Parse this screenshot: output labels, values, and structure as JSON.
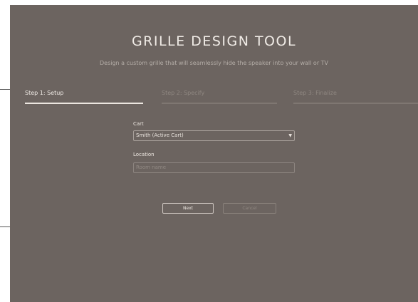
{
  "header": {
    "title": "GRILLE DESIGN TOOL",
    "subtitle": "Design a custom grille that will seamlessly hide the speaker into your wall or TV"
  },
  "steps": [
    {
      "label": "Step 1: Setup",
      "active": true
    },
    {
      "label": "Step 2: Specify",
      "active": false
    },
    {
      "label": "Step 3: Finalize",
      "active": false
    }
  ],
  "form": {
    "cart_label": "Cart",
    "cart_value": "Smith (Active Cart)",
    "location_label": "Location",
    "location_placeholder": "Room name"
  },
  "buttons": {
    "next_label": "Next",
    "cancel_label": "Cancel"
  },
  "colors": {
    "background": "#6c6460",
    "text_light": "#f0ebe6",
    "text_muted": "#8f8781"
  }
}
